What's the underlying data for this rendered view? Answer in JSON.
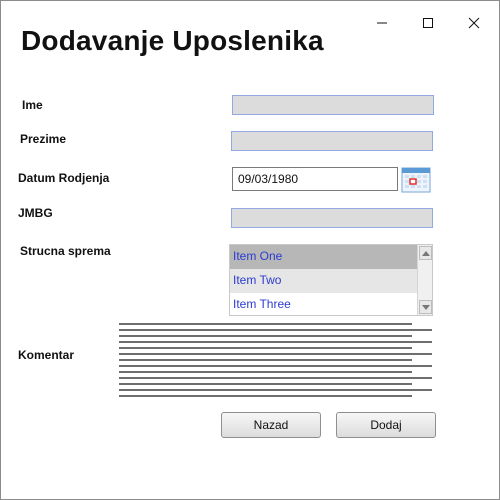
{
  "window": {
    "title": "Dodavanje Uposlenika",
    "controls": [
      "minimize-icon",
      "maximize-icon",
      "close-icon"
    ]
  },
  "form": {
    "ime": {
      "label": "Ime",
      "value": ""
    },
    "prezime": {
      "label": "Prezime",
      "value": ""
    },
    "datum_rodjenja": {
      "label": "Datum Rodjenja",
      "value": "09/03/1980",
      "icon": "calendar-icon"
    },
    "jmbg": {
      "label": "JMBG",
      "value": ""
    },
    "strucna_sprema": {
      "label": "Strucna sprema",
      "options": [
        "Item One",
        "Item Two",
        "Item Three"
      ],
      "selected": "Item One"
    },
    "komentar": {
      "label": "Komentar",
      "value": ""
    }
  },
  "buttons": {
    "back_label": "Nazad",
    "add_label": "Dodaj"
  },
  "colors": {
    "field_fill": "#dcdcdc",
    "field_border": "#92a9e6",
    "list_text": "#2b3bd0",
    "list_selected": "#b7b7b7"
  }
}
